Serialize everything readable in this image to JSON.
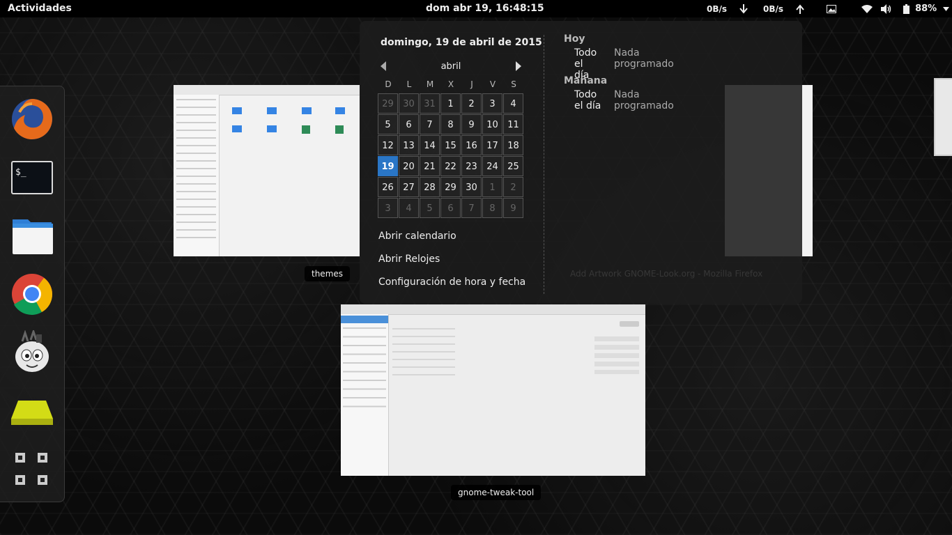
{
  "topbar": {
    "activities": "Actividades",
    "clock": "dom abr 19, 16:48:15",
    "net_down": "0B/s",
    "net_up": "0B/s",
    "battery": "88%"
  },
  "dash": {
    "items": [
      "firefox-icon",
      "terminal-icon",
      "files-icon",
      "chrome-icon",
      "gimp-icon",
      "drive-icon",
      "show-apps-icon"
    ]
  },
  "windows": {
    "files_title": "themes",
    "tweak_title": "gnome-tweak-tool",
    "faint_title": "Add Artwork GNOME-Look.org - Mozilla Firefox"
  },
  "calendar": {
    "date_title": "domingo, 19 de abril de 2015",
    "month": "abril",
    "weekdays": [
      "D",
      "L",
      "M",
      "X",
      "J",
      "V",
      "S"
    ],
    "weeks": [
      [
        "29",
        "30",
        "31",
        "1",
        "2",
        "3",
        "4"
      ],
      [
        "5",
        "6",
        "7",
        "8",
        "9",
        "10",
        "11"
      ],
      [
        "12",
        "13",
        "14",
        "15",
        "16",
        "17",
        "18"
      ],
      [
        "19",
        "20",
        "21",
        "22",
        "23",
        "24",
        "25"
      ],
      [
        "26",
        "27",
        "28",
        "29",
        "30",
        "1",
        "2"
      ],
      [
        "3",
        "4",
        "5",
        "6",
        "7",
        "8",
        "9"
      ]
    ],
    "today": "19",
    "actions": [
      "Abrir calendario",
      "Abrir Relojes",
      "Configuración de hora y fecha"
    ]
  },
  "events": {
    "today": {
      "heading": "Hoy",
      "time": "Todo el día",
      "text": "Nada programado"
    },
    "tomorrow": {
      "heading": "Mañana",
      "time": "Todo el día",
      "text": "Nada programado"
    }
  },
  "colors": {
    "accent": "#2a76c6",
    "panel": "#000000"
  }
}
